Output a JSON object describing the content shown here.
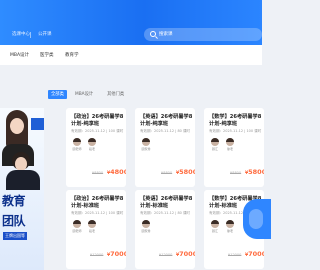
{
  "topbar": {
    "nav": [
      "选课中心",
      "公开课"
    ],
    "search_placeholder": "搜索课"
  },
  "categories": [
    "MBA设计",
    "医学类",
    "教育学"
  ],
  "filters": [
    {
      "label": "全部类",
      "active": true
    },
    {
      "label": "MBA设计",
      "active": false
    },
    {
      "label": "其他门类",
      "active": false
    }
  ],
  "banner": {
    "line1": "教育",
    "line2": "团队",
    "line3": "王牌出国等"
  },
  "cards": [
    {
      "title": "【政治】26考研暑学8计划-纯享班",
      "date": "有效期：2025.11.12 | 100 课时",
      "teachers": [
        "顾老师",
        "段老"
      ],
      "old_price": "¥8800",
      "price": "4800"
    },
    {
      "title": "【英语】26考研暑学8计划-纯享班",
      "date": "有效期：2025.11.12 | 80 课时",
      "teachers": [
        "顾家秀"
      ],
      "old_price": "¥8800",
      "price": "5800"
    },
    {
      "title": "【数学】26考研暑学8计划-纯享班",
      "date": "有效期：2025.11.12 | 100 课时",
      "teachers": [
        "颖汇",
        "徐老"
      ],
      "old_price": "¥8800",
      "price": "5800"
    },
    {
      "title": "【政治】26考研暑学8计划-标准班",
      "date": "有效期：2025.11.12 | 100 课时",
      "teachers": [
        "顾老师",
        "段老"
      ],
      "old_price": "¥12000",
      "price": "7000"
    },
    {
      "title": "【英语】26考研暑学8计划-标准班",
      "date": "有效期：2025.11.12 | 80 课时",
      "teachers": [
        "顾家秀"
      ],
      "old_price": "¥12000",
      "price": "7000"
    },
    {
      "title": "【数学】26考研暑学8计划-标准班",
      "date": "有效期：2025.11.12 | 100 课时",
      "teachers": [
        "颖汇",
        "徐老"
      ],
      "old_price": "¥12000",
      "price": "7000"
    }
  ],
  "price_symbol": "¥"
}
